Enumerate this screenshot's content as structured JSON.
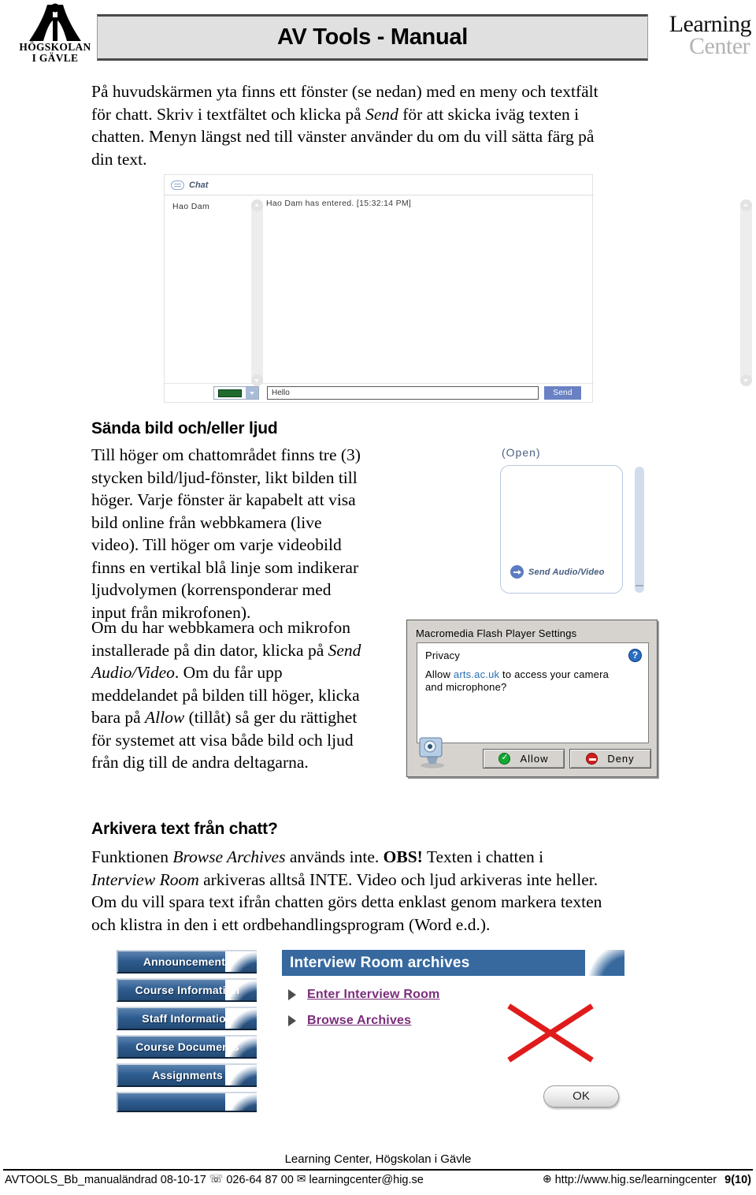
{
  "header": {
    "title": "AV Tools - Manual",
    "logo_line1": "HÖGSKOLAN",
    "logo_line2": "I GÄVLE",
    "lc_line1": "Learning",
    "lc_line2": "Center"
  },
  "intro": {
    "l1": "På huvudskärmen yta finns ett fönster (se nedan) med en meny och textfält",
    "l2_a": "för chatt. Skriv i textfältet och klicka på ",
    "l2_i": "Send",
    "l2_b": " för att skicka iväg texten i",
    "l3": "chatten. Menyn längst ned till vänster använder du om du vill sätta färg på",
    "l4": "din text."
  },
  "chat_screenshot": {
    "header_label": "Chat",
    "user": "Hao Dam",
    "message": "Hao Dam has entered.  [15:32:14 PM]",
    "input_value": "Hello",
    "send_label": "Send",
    "color_swatch": "#1f6b2e"
  },
  "section2": {
    "heading": "Sända bild och/eller ljud",
    "p1_l1": "Till höger om chattområdet finns tre (3)",
    "p1_l2": "stycken bild/ljud-fönster, likt bilden till",
    "p1_l3": "höger. Varje fönster är kapabelt att visa",
    "p1_l4": "bild online från webbkamera (live",
    "p1_l5": "video). Till höger om varje videobild",
    "p1_l6": "finns en vertikal blå linje som indikerar",
    "p1_l7": "ljudvolymen (korrensponderar med",
    "p1_l8": "input från mikrofonen).",
    "p2_l1": "Om du har webbkamera och mikrofon",
    "p2_l2_a": "installerade på din dator, klicka på ",
    "p2_l2_i": "Send",
    "p2_l3_i": "Audio/Video",
    "p2_l3_b": ". Om du får upp",
    "p2_l4": "meddelandet på bilden till höger, klicka",
    "p2_l5_a": "bara på ",
    "p2_l5_i": "Allow",
    "p2_l5_b": " (tillåt) så ger du rättighet",
    "p2_l6": "för systemet att visa både bild och ljud",
    "p2_l7": "från dig till de andra deltagarna."
  },
  "open_window": {
    "label": "(Open)",
    "send_av_label": "Send Audio/Video"
  },
  "flash_dialog": {
    "title": "Macromedia Flash Player Settings",
    "privacy_label": "Privacy",
    "question_a": "Allow ",
    "question_link": "arts.ac.uk",
    "question_b": " to access your camera",
    "question_c": "and microphone?",
    "allow_label": "Allow",
    "deny_label": "Deny",
    "help_glyph": "?"
  },
  "section3": {
    "heading": "Arkivera text från chatt?",
    "l1_a": "Funktionen ",
    "l1_i": "Browse Archives",
    "l1_b": " används inte. ",
    "l1_bold": "OBS!",
    "l1_c": " Texten i chatten i",
    "l2_i": "Interview Room",
    "l2_b": " arkiveras alltså INTE. Video och ljud arkiveras inte heller.",
    "l3": "Om du vill spara text ifrån chatten görs detta enklast genom markera texten",
    "l4": "och klistra in den i ett ordbehandlingsprogram (Word e.d.)."
  },
  "bb_screenshot": {
    "nav_buttons": [
      "Announcements",
      "Course Information",
      "Staff Information",
      "Course Documents",
      "Assignments",
      ""
    ],
    "banner": "Interview Room archives",
    "links": [
      "Enter Interview Room",
      "Browse Archives"
    ],
    "ok_label": "OK",
    "link_color": "#7b2d7b",
    "banner_color": "#37699f",
    "cross_color": "#e01b1b"
  },
  "footer": {
    "center": "Learning Center, Högskolan i Gävle",
    "doc_id": "AVTOOLS_Bb_manualändrad 08-10-17",
    "phone_icon": "☏",
    "phone": "026-64 87 00",
    "mail_icon": "✉",
    "email": "learningcenter@hig.se",
    "globe_icon": "⊕",
    "url": "http://www.hig.se/learningcenter",
    "page": "9(10)"
  }
}
